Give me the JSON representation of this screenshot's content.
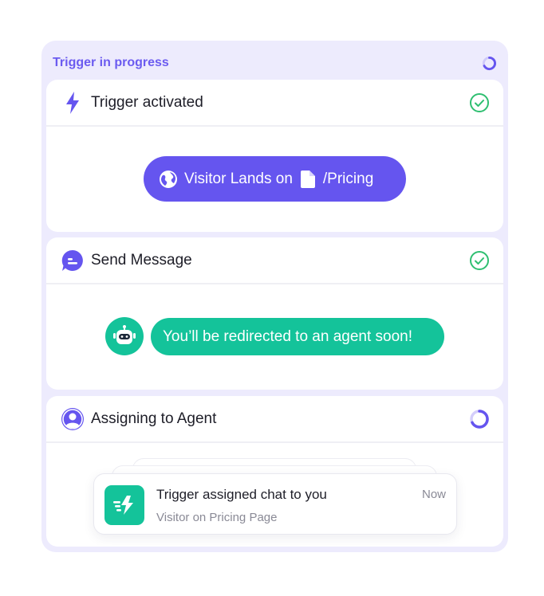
{
  "panel": {
    "title": "Trigger in progress",
    "status_icon": "spinner-icon"
  },
  "steps": [
    {
      "title": "Trigger activated",
      "icon": "lightning-icon",
      "status": "completed",
      "status_icon": "check-circle-icon",
      "event": {
        "prefix": "Visitor Lands on",
        "page": "/Pricing",
        "icons": [
          "globe-icon",
          "document-icon"
        ]
      }
    },
    {
      "title": "Send Message",
      "icon": "chat-bubble-icon",
      "status": "completed",
      "status_icon": "check-circle-icon",
      "message": {
        "text": "You’ll be redirected to an agent soon!",
        "avatar": "robot-icon"
      }
    },
    {
      "title": "Assigning to Agent",
      "icon": "user-icon",
      "status": "in-progress",
      "status_icon": "spinner-icon",
      "notification": {
        "title": "Trigger assigned chat to you",
        "subtitle": "Visitor on Pricing Page",
        "time": "Now",
        "icon": "fast-lightning-icon"
      }
    }
  ],
  "colors": {
    "accent": "#6555ef",
    "panel_bg": "#edebfd",
    "success": "#14c39a",
    "check": "#2fbf71"
  }
}
